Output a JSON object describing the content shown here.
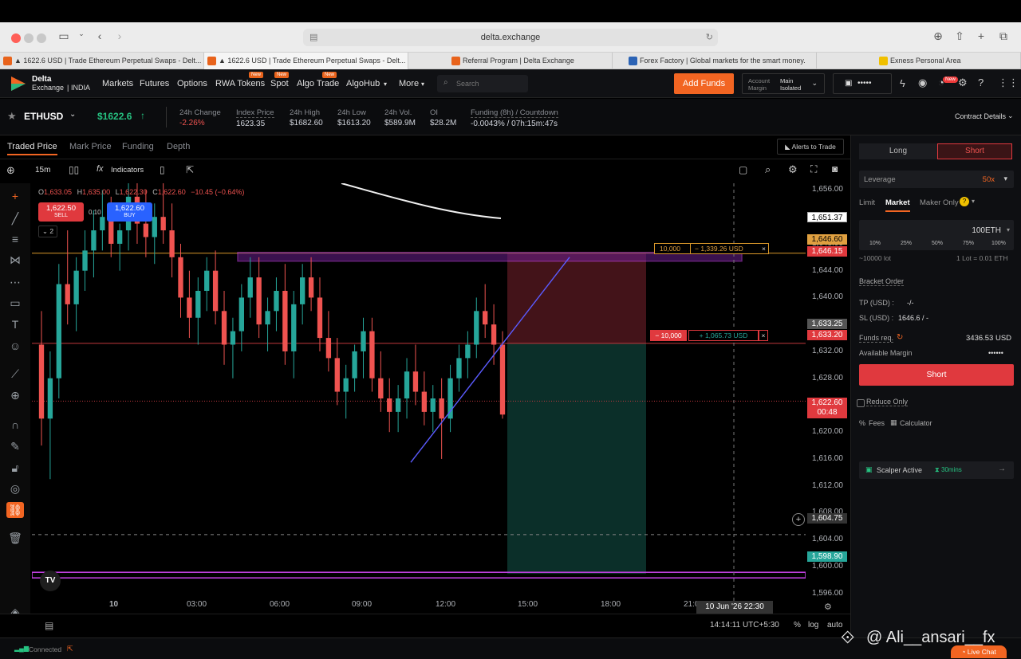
{
  "browser": {
    "url": "delta.exchange",
    "tabs": [
      {
        "label": "▲ 1622.6 USD | Trade Ethereum Perpetual Swaps - Delt...",
        "color": "#e8631c"
      },
      {
        "label": "▲ 1622.6 USD | Trade Ethereum Perpetual Swaps - Delt...",
        "color": "#e8631c"
      },
      {
        "label": "Referral Program | Delta Exchange",
        "color": "#e8631c"
      },
      {
        "label": "Forex Factory | Global markets for the smart money.",
        "color": "#2b63b5"
      },
      {
        "label": "Exness Personal Area",
        "color": "#f0c000"
      }
    ]
  },
  "nav": {
    "logo_top": "Delta",
    "logo_bottom": "Exchange",
    "logo_region": "INDIA",
    "items": [
      "Markets",
      "Futures",
      "Options",
      "RWA Tokens",
      "Spot",
      "Algo Trade",
      "AlgoHub",
      "More"
    ],
    "new_badge": "New",
    "search_placeholder": "Search",
    "add_funds": "Add Funds",
    "account_label_1": "Account",
    "account_label_2": "Margin",
    "account_value_1": "Main",
    "account_value_2": "Isolated",
    "balance_masked": "•••••",
    "notif_badge": "New"
  },
  "ticker": {
    "symbol": "ETHUSD",
    "price": "$1622.6",
    "stats": [
      {
        "label": "24h Change",
        "value": "-2.26%",
        "color": "#ef5350"
      },
      {
        "label": "Index Price",
        "value": "1623.35",
        "color": "#d1d4dc"
      },
      {
        "label": "24h High",
        "value": "$1682.60",
        "color": "#d1d4dc"
      },
      {
        "label": "24h Low",
        "value": "$1613.20",
        "color": "#d1d4dc"
      },
      {
        "label": "24h Vol.",
        "value": "$589.9M",
        "color": "#d1d4dc"
      },
      {
        "label": "OI",
        "value": "$28.2M",
        "color": "#d1d4dc"
      },
      {
        "label": "Funding (8h) / Countdown",
        "value": "-0.0043% / 07h:15m:47s",
        "color": "#d1d4dc"
      }
    ],
    "contract_details": "Contract Details"
  },
  "chart_tabs": [
    "Traded Price",
    "Mark Price",
    "Funding",
    "Depth"
  ],
  "alerts_button": "Alerts to Trade",
  "toolbar": {
    "interval": "15m",
    "indicators": "Indicators"
  },
  "legend": {
    "o_label": "O",
    "o": "1,633.05",
    "h_label": "H",
    "h": "1,635.00",
    "l_label": "L",
    "l": "1,622.30",
    "c_label": "C",
    "c": "1,622.60",
    "change": "−10.45 (−0.64%)",
    "sell_price": "1,622.50",
    "sell_label": "SELL",
    "spread": "0.10",
    "buy_price": "1,622.60",
    "buy_label": "BUY",
    "collapse_count": "2"
  },
  "chart_data": {
    "type": "candlestick",
    "y_ticks": [
      "1,656.00",
      "1,652.00",
      "1,648.00",
      "1,644.00",
      "1,640.00",
      "1,636.00",
      "1,632.00",
      "1,628.00",
      "1,624.00",
      "1,620.00",
      "1,616.00",
      "1,612.00",
      "1,608.00",
      "1,604.00",
      "1,600.00",
      "1,596.00"
    ],
    "ylim": [
      1593,
      1657
    ],
    "x_ticks": [
      "10",
      "03:00",
      "06:00",
      "09:00",
      "12:00",
      "15:00",
      "18:00",
      "21:00"
    ],
    "candles": [
      [
        1633,
        1638,
        1618,
        1622
      ],
      [
        1622,
        1632,
        1613,
        1628
      ],
      [
        1628,
        1645,
        1625,
        1642
      ],
      [
        1642,
        1650,
        1636,
        1639
      ],
      [
        1639,
        1646,
        1635,
        1644
      ],
      [
        1644,
        1650,
        1641,
        1647
      ],
      [
        1647,
        1653,
        1643,
        1650
      ],
      [
        1650,
        1656,
        1647,
        1652
      ],
      [
        1652,
        1655,
        1646,
        1648
      ],
      [
        1648,
        1651,
        1644,
        1650
      ],
      [
        1650,
        1658,
        1647,
        1655
      ],
      [
        1655,
        1659,
        1648,
        1651
      ],
      [
        1651,
        1656,
        1646,
        1649
      ],
      [
        1649,
        1654,
        1645,
        1652
      ],
      [
        1652,
        1657,
        1648,
        1650
      ],
      [
        1650,
        1654,
        1643,
        1646
      ],
      [
        1646,
        1648,
        1637,
        1640
      ],
      [
        1640,
        1644,
        1634,
        1637
      ],
      [
        1637,
        1643,
        1633,
        1641
      ],
      [
        1641,
        1646,
        1638,
        1644
      ],
      [
        1644,
        1647,
        1636,
        1638
      ],
      [
        1638,
        1641,
        1630,
        1633
      ],
      [
        1633,
        1637,
        1628,
        1635
      ],
      [
        1635,
        1642,
        1632,
        1640
      ],
      [
        1640,
        1646,
        1637,
        1643
      ],
      [
        1643,
        1646,
        1634,
        1636
      ],
      [
        1636,
        1640,
        1632,
        1638
      ],
      [
        1638,
        1643,
        1635,
        1641
      ],
      [
        1641,
        1645,
        1630,
        1632
      ],
      [
        1632,
        1641,
        1628,
        1639
      ],
      [
        1639,
        1645,
        1636,
        1643
      ],
      [
        1643,
        1646,
        1638,
        1640
      ],
      [
        1640,
        1643,
        1632,
        1634
      ],
      [
        1634,
        1638,
        1629,
        1631
      ],
      [
        1631,
        1634,
        1624,
        1626
      ],
      [
        1626,
        1630,
        1622,
        1628
      ],
      [
        1628,
        1633,
        1626,
        1632
      ],
      [
        1632,
        1637,
        1628,
        1635
      ],
      [
        1635,
        1637,
        1626,
        1628
      ],
      [
        1628,
        1632,
        1623,
        1625
      ],
      [
        1625,
        1628,
        1620,
        1623
      ],
      [
        1623,
        1627,
        1620,
        1625
      ],
      [
        1625,
        1631,
        1622,
        1629
      ],
      [
        1629,
        1633,
        1624,
        1626
      ],
      [
        1626,
        1629,
        1621,
        1623
      ],
      [
        1623,
        1627,
        1620,
        1625
      ],
      [
        1625,
        1628,
        1616,
        1622
      ],
      [
        1622,
        1630,
        1620,
        1628
      ],
      [
        1628,
        1633,
        1626,
        1631
      ],
      [
        1631,
        1635,
        1628,
        1633
      ],
      [
        1633,
        1640,
        1631,
        1638
      ],
      [
        1638,
        1642,
        1634,
        1636
      ],
      [
        1636,
        1639,
        1630,
        1633
      ],
      [
        1633,
        1635,
        1622,
        1622.6
      ]
    ],
    "ma_line": [
      [
        1655.5,
        0.56
      ],
      [
        1652.5,
        0.73
      ]
    ],
    "h_lines": [
      1646.6,
      1633.2,
      1624.6,
      1604.75,
      1598.9
    ],
    "zone_top": 1646.6,
    "zone_bottom": 1598.9,
    "entry": 1633.2
  },
  "price_tags": {
    "tp": "1,646.60",
    "sl": "1,646.15",
    "mid_1": "1,633.25",
    "mid_2": "1,633.20",
    "last": "1,622.60",
    "countdown": "00:48",
    "cross": "1,604.75",
    "bottom": "1,598.90",
    "crosshair": "1,651.37"
  },
  "order_labels": {
    "tp_qty": "10,000",
    "tp_pnl": "− 1,339.26 USD",
    "entry_qty": "− 10,000",
    "entry_pnl": "+ 1,065.73 USD"
  },
  "crosshair_date": "10 Jun '26  22:30",
  "bottom_bar": {
    "time": "14:14:11 UTC+5:30",
    "pct": "%",
    "log": "log",
    "auto": "auto"
  },
  "panel": {
    "long": "Long",
    "short": "Short",
    "leverage_label": "Leverage",
    "leverage_value": "50x",
    "order_types": [
      "Limit",
      "Market",
      "Maker Only"
    ],
    "qty": "100",
    "qty_unit": "ETH",
    "pcts": [
      "10%",
      "25%",
      "50%",
      "75%",
      "100%"
    ],
    "lot_left": "~10000 lot",
    "lot_right": "1 Lot = 0.01 ETH",
    "bracket": "Bracket Order",
    "tp_label": "TP (USD) :",
    "tp_value": "-/-",
    "sl_label": "SL (USD) :",
    "sl_value": "1646.6 / -",
    "funds_label": "Funds req.",
    "funds_value": "3436.53 USD",
    "margin_label": "Available Margin",
    "margin_value": "••••••",
    "short_button": "Short",
    "reduce_only": "Reduce Only",
    "fees": "Fees",
    "calculator": "Calculator",
    "scalper": "Scalper Active",
    "scalper_time": "30mins"
  },
  "status": {
    "connected": "Connected",
    "watermark": "@ Ali__ansari__fx",
    "live_chat": "Live Chat"
  },
  "colors": {
    "up": "#26a69a",
    "down": "#ef5350",
    "accent": "#f26522",
    "purple": "#c040e0"
  }
}
